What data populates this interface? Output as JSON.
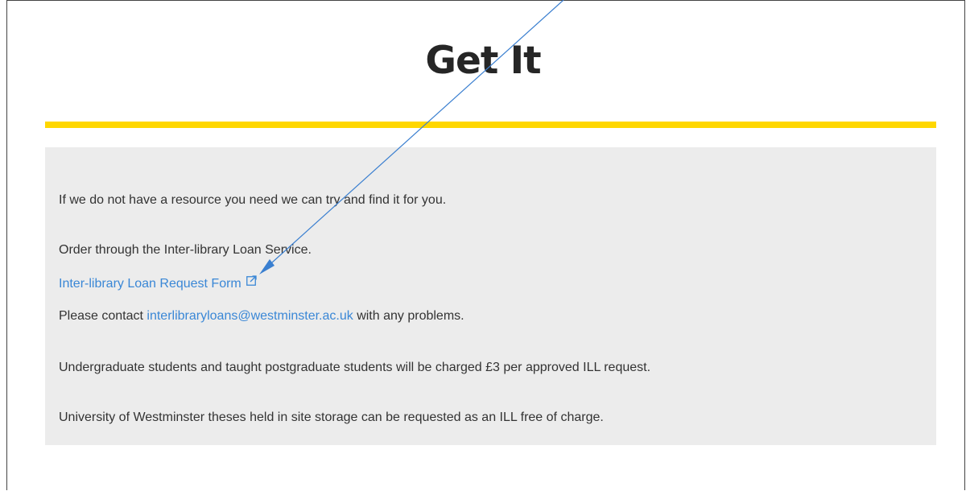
{
  "page": {
    "title": "Get It"
  },
  "colors": {
    "accent_rule": "#ffd700",
    "panel_bg": "#ececec",
    "link": "#3a87d6",
    "text": "#333333",
    "annotation_arrow": "#3a7fd0"
  },
  "content": {
    "intro": "If we do not have a resource you need we can try and find it for you.",
    "order_text": "Order through the Inter-library Loan Service.",
    "request_form_link": "Inter-library Loan Request Form",
    "request_form_icon": "external-link-icon",
    "contact_prefix": "Please contact ",
    "contact_email": "interlibraryloans@westminster.ac.uk",
    "contact_suffix": " with any problems.",
    "charge_note": "Undergraduate students and taught postgraduate students will be charged £3 per approved ILL request.",
    "theses_note": "University of Westminster theses held in site storage can be requested as an ILL free of charge."
  },
  "annotation": {
    "icon": "annotation-arrow-icon"
  }
}
